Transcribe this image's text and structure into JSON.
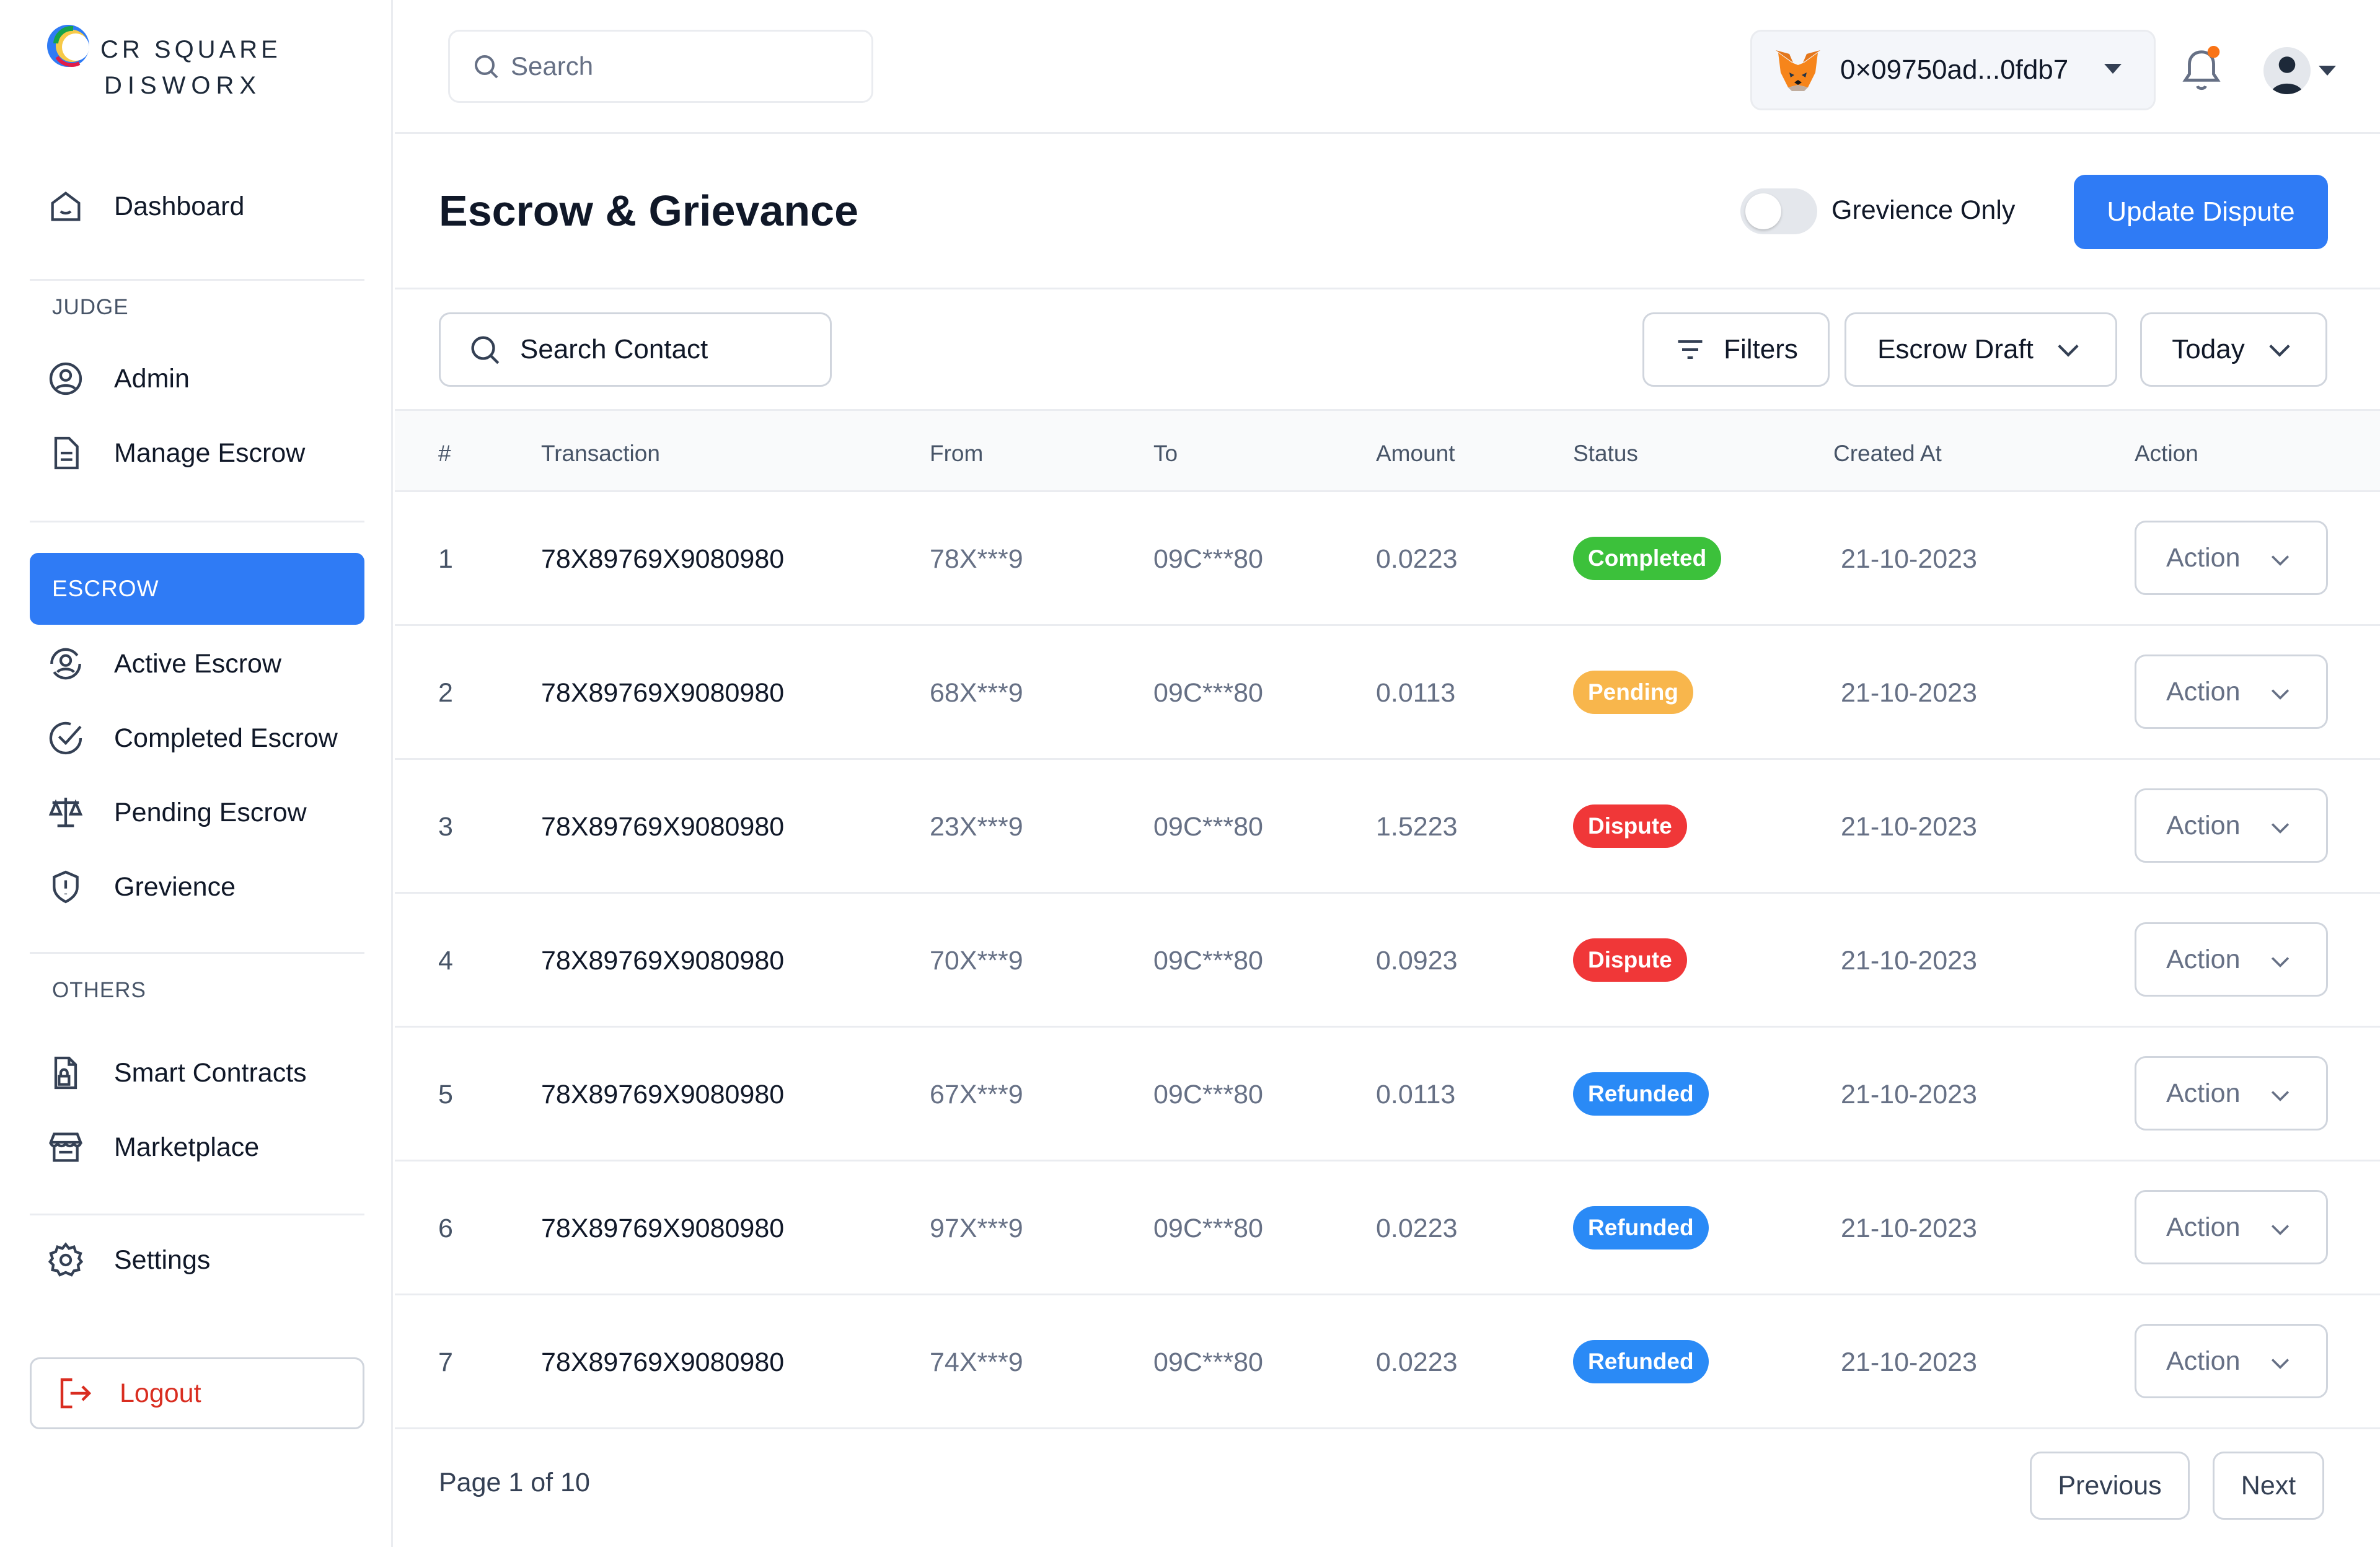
{
  "brand": {
    "line1": "CR SQUARE",
    "line2": "DISWORX"
  },
  "sidebar": {
    "dashboard": "Dashboard",
    "judge_label": "JUDGE",
    "judge_items": [
      "Admin",
      "Manage Escrow"
    ],
    "escrow_label": "ESCROW",
    "escrow_items": [
      "Active Escrow",
      "Completed Escrow",
      "Pending Escrow",
      "Grevience"
    ],
    "others_label": "OTHERS",
    "others_items": [
      "Smart Contracts",
      "Marketplace"
    ],
    "settings": "Settings",
    "logout": "Logout"
  },
  "topbar": {
    "search_placeholder": "Search",
    "wallet_address": "0×09750ad...0fdb7"
  },
  "page": {
    "title": "Escrow & Grievance",
    "toggle_label": "Grevience Only",
    "toggle_on": false,
    "update_button": "Update Dispute"
  },
  "filters": {
    "search_placeholder": "Search Contact",
    "filters_label": "Filters",
    "type_select": "Escrow Draft",
    "date_select": "Today"
  },
  "table": {
    "headers": [
      "#",
      "Transaction",
      "From",
      "To",
      "Amount",
      "Status",
      "Created At",
      "Action"
    ],
    "rows": [
      {
        "n": "1",
        "tx": "78X89769X9080980",
        "from": "78X***9",
        "to": "09C***80",
        "amount": "0.0223",
        "status": "Completed",
        "created": "21-10-2023",
        "action": "Action"
      },
      {
        "n": "2",
        "tx": "78X89769X9080980",
        "from": "68X***9",
        "to": "09C***80",
        "amount": "0.0113",
        "status": "Pending",
        "created": "21-10-2023",
        "action": "Action"
      },
      {
        "n": "3",
        "tx": "78X89769X9080980",
        "from": "23X***9",
        "to": "09C***80",
        "amount": "1.5223",
        "status": "Dispute",
        "created": "21-10-2023",
        "action": "Action"
      },
      {
        "n": "4",
        "tx": "78X89769X9080980",
        "from": "70X***9",
        "to": "09C***80",
        "amount": "0.0923",
        "status": "Dispute",
        "created": "21-10-2023",
        "action": "Action"
      },
      {
        "n": "5",
        "tx": "78X89769X9080980",
        "from": "67X***9",
        "to": "09C***80",
        "amount": "0.0113",
        "status": "Refunded",
        "created": "21-10-2023",
        "action": "Action"
      },
      {
        "n": "6",
        "tx": "78X89769X9080980",
        "from": "97X***9",
        "to": "09C***80",
        "amount": "0.0223",
        "status": "Refunded",
        "created": "21-10-2023",
        "action": "Action"
      },
      {
        "n": "7",
        "tx": "78X89769X9080980",
        "from": "74X***9",
        "to": "09C***80",
        "amount": "0.0223",
        "status": "Refunded",
        "created": "21-10-2023",
        "action": "Action"
      }
    ]
  },
  "status_colors": {
    "Completed": "#3cc13b",
    "Pending": "#f8b64c",
    "Dispute": "#f03738",
    "Refunded": "#2a8af6"
  },
  "accent_color": "#2f7bf5",
  "pagination": {
    "text": "Page 1 of 10",
    "previous": "Previous",
    "next": "Next"
  }
}
